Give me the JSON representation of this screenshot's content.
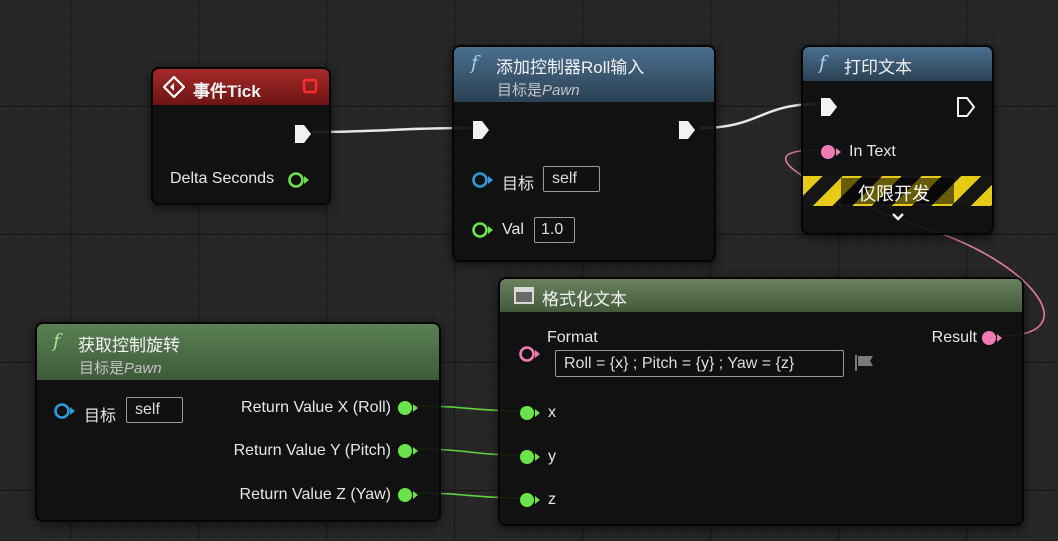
{
  "colors": {
    "exec": "#f2f2f2",
    "float": "#6be34a",
    "object": "#2f9bde",
    "text": "#f07cb6",
    "header_event": "#8a1f1f",
    "header_function": "#3a5f7d",
    "header_pure": "#4f7147",
    "header_format": "#56684c",
    "dev_stripe_yellow": "#e6cc17"
  },
  "nodes": {
    "event_tick": {
      "title": "事件Tick",
      "delta_label": "Delta Seconds"
    },
    "add_roll": {
      "title": "添加控制器Roll输入",
      "subtitle_prefix": "目标是",
      "subtitle_class": "Pawn",
      "target_label": "目标",
      "target_value": "self",
      "val_label": "Val",
      "val_value": "1.0"
    },
    "print_text": {
      "title": "打印文本",
      "in_text_label": "In Text",
      "dev_only": "仅限开发"
    },
    "get_rotation": {
      "title": "获取控制旋转",
      "subtitle_prefix": "目标是",
      "subtitle_class": "Pawn",
      "target_label": "目标",
      "target_value": "self",
      "out_x": "Return Value X (Roll)",
      "out_y": "Return Value Y (Pitch)",
      "out_z": "Return Value Z (Yaw)"
    },
    "format_text": {
      "title": "格式化文本",
      "format_label": "Format",
      "format_value": "Roll = {x} ; Pitch = {y} ; Yaw = {z}",
      "result_label": "Result",
      "in_x": "x",
      "in_y": "y",
      "in_z": "z"
    }
  }
}
